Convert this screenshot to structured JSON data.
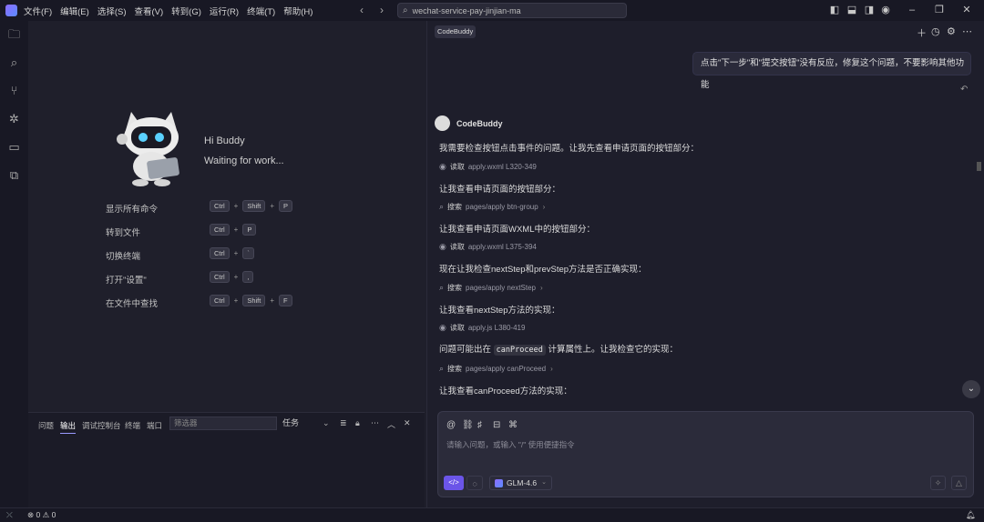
{
  "titlebar": {
    "menu": [
      "文件(F)",
      "编辑(E)",
      "选择(S)",
      "查看(V)",
      "转到(G)",
      "运行(R)",
      "终端(T)",
      "帮助(H)"
    ],
    "search_value": "wechat-service-pay-jinjian-ma"
  },
  "editor": {
    "greeting": "Hi Buddy",
    "status": "Waiting for work...",
    "shortcuts": [
      {
        "label": "显示所有命令",
        "keys": [
          "Ctrl",
          "Shift",
          "P"
        ]
      },
      {
        "label": "转到文件",
        "keys": [
          "Ctrl",
          "P"
        ]
      },
      {
        "label": "切换终端",
        "keys": [
          "Ctrl",
          "`"
        ]
      },
      {
        "label": "打开\"设置\"",
        "keys": [
          "Ctrl",
          ","
        ]
      },
      {
        "label": "在文件中查找",
        "keys": [
          "Ctrl",
          "Shift",
          "F"
        ]
      }
    ]
  },
  "panel": {
    "tabs": [
      "问题",
      "输出",
      "调试控制台",
      "终端",
      "端口"
    ],
    "filter_placeholder": "筛选器",
    "task_select": "任务"
  },
  "chat": {
    "tab_label": "CodeBuddy",
    "user_message": "点击\"下一步\"和\"提交按钮\"没有反应，修复这个问题，不要影响其他功能",
    "assistant_name": "CodeBuddy",
    "messages": [
      "我需要检查按钮点击事件的问题。让我先查看申请页面的按钮部分：",
      "让我查看申请页面的按钮部分：",
      "让我查看申请页面WXML中的按钮部分：",
      "现在让我检查nextStep和prevStep方法是否正确实现：",
      "让我查看nextStep方法的实现：",
      "计算属性上。让我检查它的实现：",
      "让我查看canProceed方法的实现："
    ],
    "msg5_prefix": "问题可能出在",
    "msg5_code": "canProceed",
    "tools": [
      {
        "verb": "读取",
        "target": "apply.wxml L320-349"
      },
      {
        "verb": "搜索",
        "target": "pages/apply btn-group"
      },
      {
        "verb": "读取",
        "target": "apply.wxml L375-394"
      },
      {
        "verb": "搜索",
        "target": "pages/apply nextStep"
      },
      {
        "verb": "读取",
        "target": "apply.js L380-419"
      },
      {
        "verb": "搜索",
        "target": "pages/apply canProceed"
      }
    ],
    "composer_placeholder": "请输入问题，或输入 \"/\" 使用便捷指令",
    "model": "GLM-4.6"
  },
  "statusbar": {
    "errors": "0",
    "warnings": "0"
  }
}
